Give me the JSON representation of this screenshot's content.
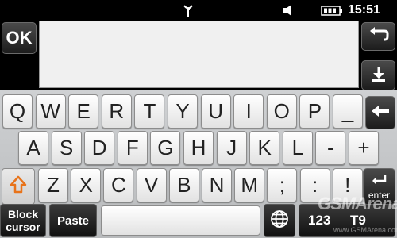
{
  "status_bar": {
    "time": "15:51",
    "icons": [
      "signal-icon",
      "speaker-icon",
      "battery-icon"
    ]
  },
  "toolbar": {
    "ok_label": "OK",
    "back_icon": "back-arrow-icon",
    "hide_keyboard_icon": "download-arrow-icon"
  },
  "text_area": {
    "value": ""
  },
  "keyboard": {
    "row1": [
      "Q",
      "W",
      "E",
      "R",
      "T",
      "Y",
      "U",
      "I",
      "O",
      "P",
      "_"
    ],
    "row2": [
      "A",
      "S",
      "D",
      "F",
      "G",
      "H",
      "J",
      "K",
      "L",
      "-",
      "+"
    ],
    "row3": [
      "Z",
      "X",
      "C",
      "V",
      "B",
      "N",
      "M",
      ";",
      ":",
      "!"
    ],
    "shift_icon": "shift-arrow-icon",
    "backspace_icon": "backspace-arrow-icon",
    "enter_label": "enter",
    "block_cursor_line1": "Block",
    "block_cursor_line2": "cursor",
    "paste_label": "Paste",
    "globe_icon": "globe-icon",
    "mode_numeric": "123",
    "mode_t9": "T9"
  },
  "watermark": {
    "brand": "GSMArena",
    "site": "www.GSMArena.com"
  },
  "colors": {
    "accent": "#e8731a",
    "dark_button": "#1c1c1c",
    "key_face": "#f4f4f4",
    "panel": "#c4c6c8"
  }
}
